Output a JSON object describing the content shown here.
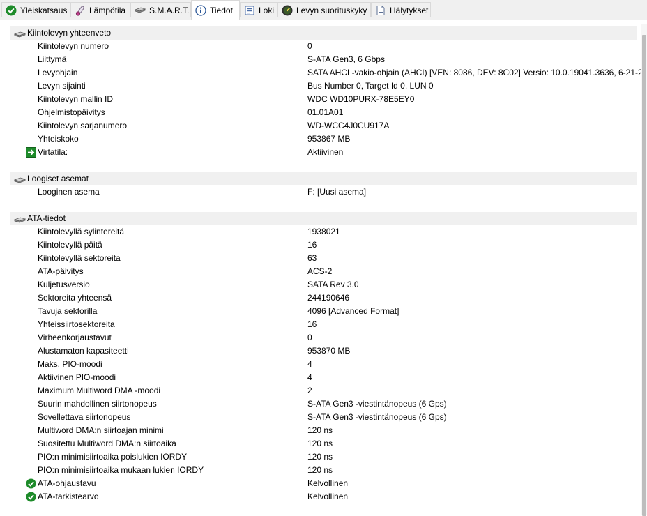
{
  "tabs": [
    {
      "label": "Yleiskatsaus",
      "icon": "check-circle-icon"
    },
    {
      "label": "Lämpötila",
      "icon": "thermometer-icon"
    },
    {
      "label": "S.M.A.R.T.",
      "icon": "drive-icon"
    },
    {
      "label": "Tiedot",
      "icon": "info-icon"
    },
    {
      "label": "Loki",
      "icon": "log-icon"
    },
    {
      "label": "Levyn suorituskyky",
      "icon": "speedometer-icon"
    },
    {
      "label": "Hälytykset",
      "icon": "alerts-icon"
    }
  ],
  "active_tab": "Tiedot",
  "sections": [
    {
      "title": "Kiintolevyn yhteenveto",
      "rows": [
        {
          "key": "Kiintolevyn numero",
          "value": "0"
        },
        {
          "key": "Liittymä",
          "value": "S-ATA Gen3, 6 Gbps"
        },
        {
          "key": "Levyohjain",
          "value": "SATA AHCI -vakio-ohjain (AHCI) [VEN: 8086, DEV: 8C02] Versio: 10.0.19041.3636, 6-21-2..."
        },
        {
          "key": "Levyn sijainti",
          "value": "Bus Number 0, Target Id 0, LUN 0"
        },
        {
          "key": "Kiintolevyn mallin ID",
          "value": "WDC WD10PURX-78E5EY0"
        },
        {
          "key": "Ohjelmistopäivitys",
          "value": "01.01A01"
        },
        {
          "key": "Kiintolevyn sarjanumero",
          "value": "WD-WCC4J0CU917A"
        },
        {
          "key": "Yhteiskoko",
          "value": "953867 MB"
        },
        {
          "key": "Virtatila:",
          "value": "Aktiivinen",
          "icon": "power-arrow-icon"
        }
      ]
    },
    {
      "title": "Loogiset asemat",
      "rows": [
        {
          "key": "Looginen asema",
          "value": "F: [Uusi asema]"
        }
      ]
    },
    {
      "title": "ATA-tiedot",
      "rows": [
        {
          "key": "Kiintolevyllä sylintereitä",
          "value": "1938021"
        },
        {
          "key": "Kiintolevyllä päitä",
          "value": "16"
        },
        {
          "key": "Kiintolevyllä sektoreita",
          "value": "63"
        },
        {
          "key": "ATA-päivitys",
          "value": "ACS-2"
        },
        {
          "key": "Kuljetusversio",
          "value": "SATA Rev 3.0"
        },
        {
          "key": "Sektoreita yhteensä",
          "value": "244190646"
        },
        {
          "key": "Tavuja sektorilla",
          "value": "4096 [Advanced Format]"
        },
        {
          "key": "Yhteissiirtosektoreita",
          "value": "16"
        },
        {
          "key": "Virheenkorjaustavut",
          "value": "0"
        },
        {
          "key": "Alustamaton kapasiteetti",
          "value": "953870 MB"
        },
        {
          "key": "Maks. PIO-moodi",
          "value": "4"
        },
        {
          "key": "Aktiivinen PIO-moodi",
          "value": "4"
        },
        {
          "key": "Maximum Multiword DMA -moodi",
          "value": "2"
        },
        {
          "key": "Suurin mahdollinen siirtonopeus",
          "value": "S-ATA Gen3 -viestintänopeus (6 Gps)"
        },
        {
          "key": "Sovellettava siirtonopeus",
          "value": "S-ATA Gen3 -viestintänopeus (6 Gps)"
        },
        {
          "key": "Multiword DMA:n siirtoajan minimi",
          "value": "120 ns"
        },
        {
          "key": "Suositettu Multiword DMA:n siirtoaika",
          "value": "120 ns"
        },
        {
          "key": "PIO:n minimisiirtoaika poislukien IORDY",
          "value": "120 ns"
        },
        {
          "key": "PIO:n minimisiirtoaika mukaan lukien IORDY",
          "value": "120 ns"
        },
        {
          "key": "ATA-ohjaustavu",
          "value": "Kelvollinen",
          "icon": "check-circle-icon"
        },
        {
          "key": "ATA-tarkistearvo",
          "value": "Kelvollinen",
          "icon": "check-circle-icon"
        }
      ]
    }
  ],
  "colors": {
    "check_green": "#1e8b2a",
    "group_bg": "#f0f0f0",
    "tabbar_bg": "#f0f0f0"
  }
}
